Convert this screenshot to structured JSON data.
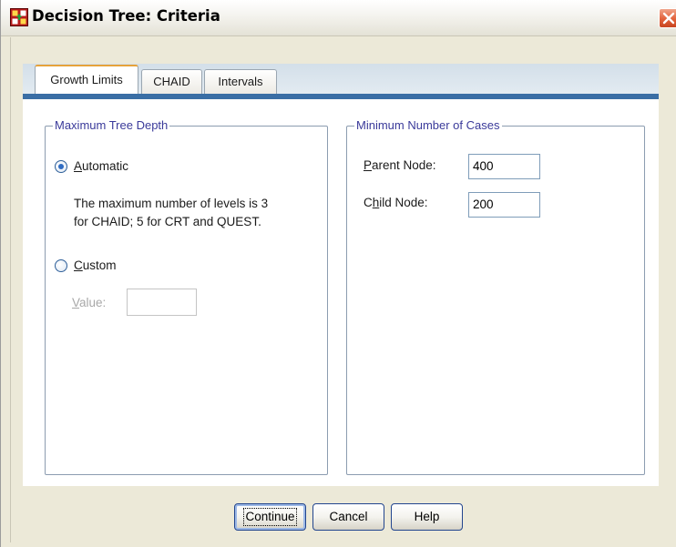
{
  "window": {
    "title": "Decision Tree: Criteria"
  },
  "tabs": [
    {
      "label": "Growth Limits",
      "active": true
    },
    {
      "label": "CHAID",
      "active": false
    },
    {
      "label": "Intervals",
      "active": false
    }
  ],
  "depth_group": {
    "legend": "Maximum Tree Depth",
    "automatic_label": "Automatic",
    "automatic_mnemonic": "A",
    "automatic_rest": "utomatic",
    "automatic_selected": true,
    "description_line1": "The maximum number of levels is 3",
    "description_line2": "for CHAID; 5 for CRT and QUEST.",
    "custom_label": "Custom",
    "custom_mnemonic": "C",
    "custom_rest": "ustom",
    "custom_selected": false,
    "value_label": "Value:",
    "value_mnemonic": "V",
    "value_rest": "alue:",
    "value": ""
  },
  "cases_group": {
    "legend": "Minimum Number of Cases",
    "parent_label": "Parent Node:",
    "parent_mnemonic": "P",
    "parent_rest": "arent Node:",
    "parent_value": "400",
    "child_label": "Child Node:",
    "child_pre": "C",
    "child_mnemonic": "h",
    "child_rest": "ild Node:",
    "child_value": "200"
  },
  "buttons": {
    "continue": "Continue",
    "cancel": "Cancel",
    "help": "Help"
  },
  "colors": {
    "accent": "#3a6ea5",
    "group_title": "#3a3a9a",
    "tab_highlight": "#e6a23a",
    "close_button": "#e2613a"
  },
  "icons": {
    "app": "decision-tree-app-icon",
    "close": "close-icon"
  }
}
